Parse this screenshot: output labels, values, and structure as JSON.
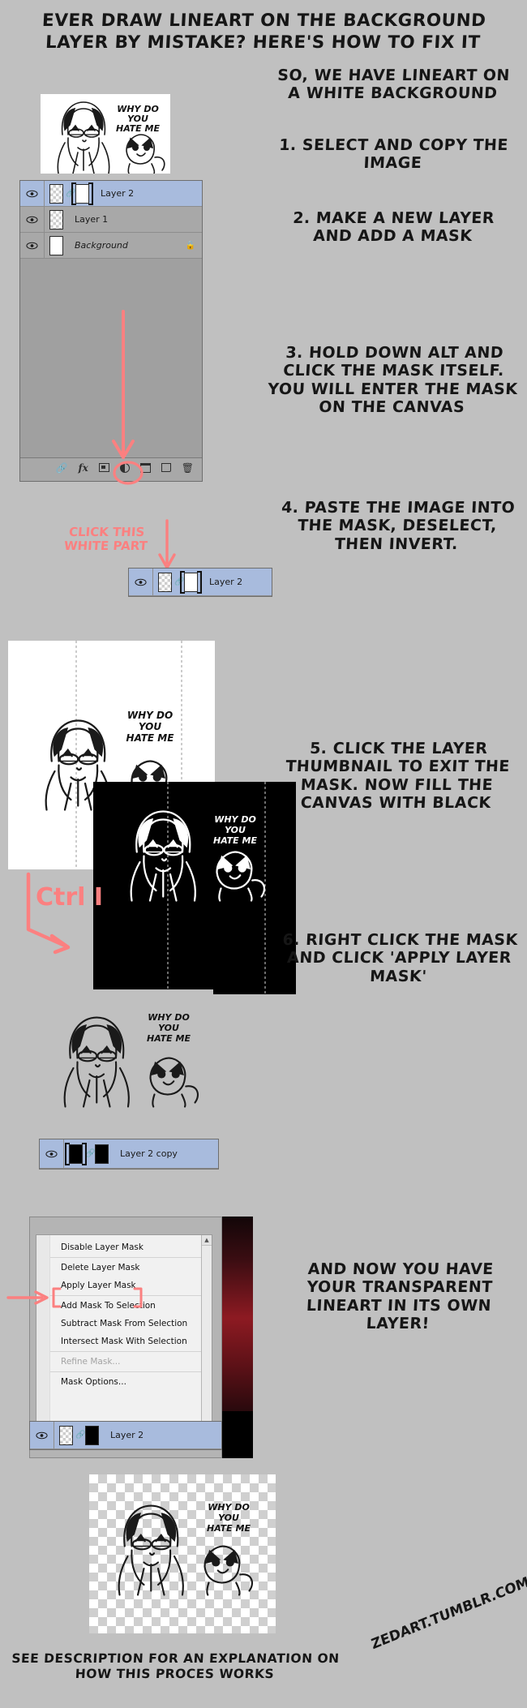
{
  "title": "EVER DRAW LINEART ON THE BACKGROUND LAYER BY MISTAKE? HERE'S HOW TO FIX IT",
  "captions": {
    "intro": "SO, WE HAVE LINEART ON A WHITE BACKGROUND",
    "step1": "1. SELECT AND COPY THE IMAGE",
    "step2": "2. MAKE A NEW LAYER AND ADD A MASK",
    "step3": "3. HOLD DOWN ALT AND CLICK THE MASK ITSELF. YOU WILL ENTER THE MASK ON THE CANVAS",
    "step4": "4. PASTE THE IMAGE INTO THE MASK, DESELECT, THEN INVERT.",
    "step5": "5. CLICK THE LAYER THUMBNAIL TO EXIT THE MASK. NOW FILL THE CANVAS WITH BLACK",
    "step6": "6. RIGHT CLICK THE MASK AND CLICK 'APPLY LAYER MASK'",
    "final": "AND NOW YOU HAVE YOUR TRANSPARENT LINEART IN ITS OWN LAYER!"
  },
  "footer": {
    "note": "SEE DESCRIPTION FOR AN EXPLANATION ON HOW THIS PROCES WORKS",
    "signature": "ZEDART.TUMBLR.COM"
  },
  "annotations": {
    "click_white_part": "CLICK THIS WHITE PART",
    "ctrl_i": "Ctrl I",
    "accent_color": "#fb8080"
  },
  "artwork": {
    "speech": [
      "WHY DO",
      "YOU",
      "HATE ME"
    ]
  },
  "layers_panel_1": {
    "rows": [
      {
        "name": "Layer 2",
        "selected": true,
        "italic": false,
        "locked": false,
        "thumbs": [
          "checker",
          "link",
          "white-mask-selected"
        ]
      },
      {
        "name": "Layer 1",
        "selected": false,
        "italic": false,
        "locked": false,
        "thumbs": [
          "checker"
        ]
      },
      {
        "name": "Background",
        "selected": false,
        "italic": true,
        "locked": true,
        "thumbs": [
          "white"
        ]
      }
    ],
    "toolbar_icons": [
      "link-icon",
      "fx-icon",
      "add-layer-mask-icon",
      "adjustment-layer-icon",
      "new-group-icon",
      "new-layer-icon",
      "delete-layer-icon"
    ]
  },
  "layers_panel_2": {
    "rows": [
      {
        "name": "Layer 2",
        "selected": true,
        "italic": false,
        "locked": false,
        "thumbs": [
          "checker",
          "link",
          "white-mask-selected"
        ]
      }
    ]
  },
  "layers_panel_3": {
    "rows": [
      {
        "name": "Layer 2 copy",
        "selected": true,
        "italic": false,
        "locked": false,
        "thumbs": [
          "black-mask-selected",
          "link",
          "black"
        ]
      }
    ]
  },
  "layers_panel_4": {
    "rows": [
      {
        "name": "Layer 2",
        "selected": true,
        "italic": false,
        "locked": false,
        "thumbs": [
          "checker",
          "link",
          "black"
        ]
      }
    ]
  },
  "context_menu": {
    "items": [
      {
        "label": "Disable Layer Mask",
        "disabled": false,
        "sep_after": true
      },
      {
        "label": "Delete Layer Mask",
        "disabled": false,
        "sep_after": false
      },
      {
        "label": "Apply Layer Mask",
        "disabled": false,
        "sep_after": true,
        "highlighted": true
      },
      {
        "label": "Add Mask To Selection",
        "disabled": false,
        "sep_after": false
      },
      {
        "label": "Subtract Mask From Selection",
        "disabled": false,
        "sep_after": false
      },
      {
        "label": "Intersect Mask With Selection",
        "disabled": false,
        "sep_after": true
      },
      {
        "label": "Refine Mask...",
        "disabled": true,
        "sep_after": true
      },
      {
        "label": "Mask Options...",
        "disabled": false,
        "sep_after": false
      }
    ]
  }
}
